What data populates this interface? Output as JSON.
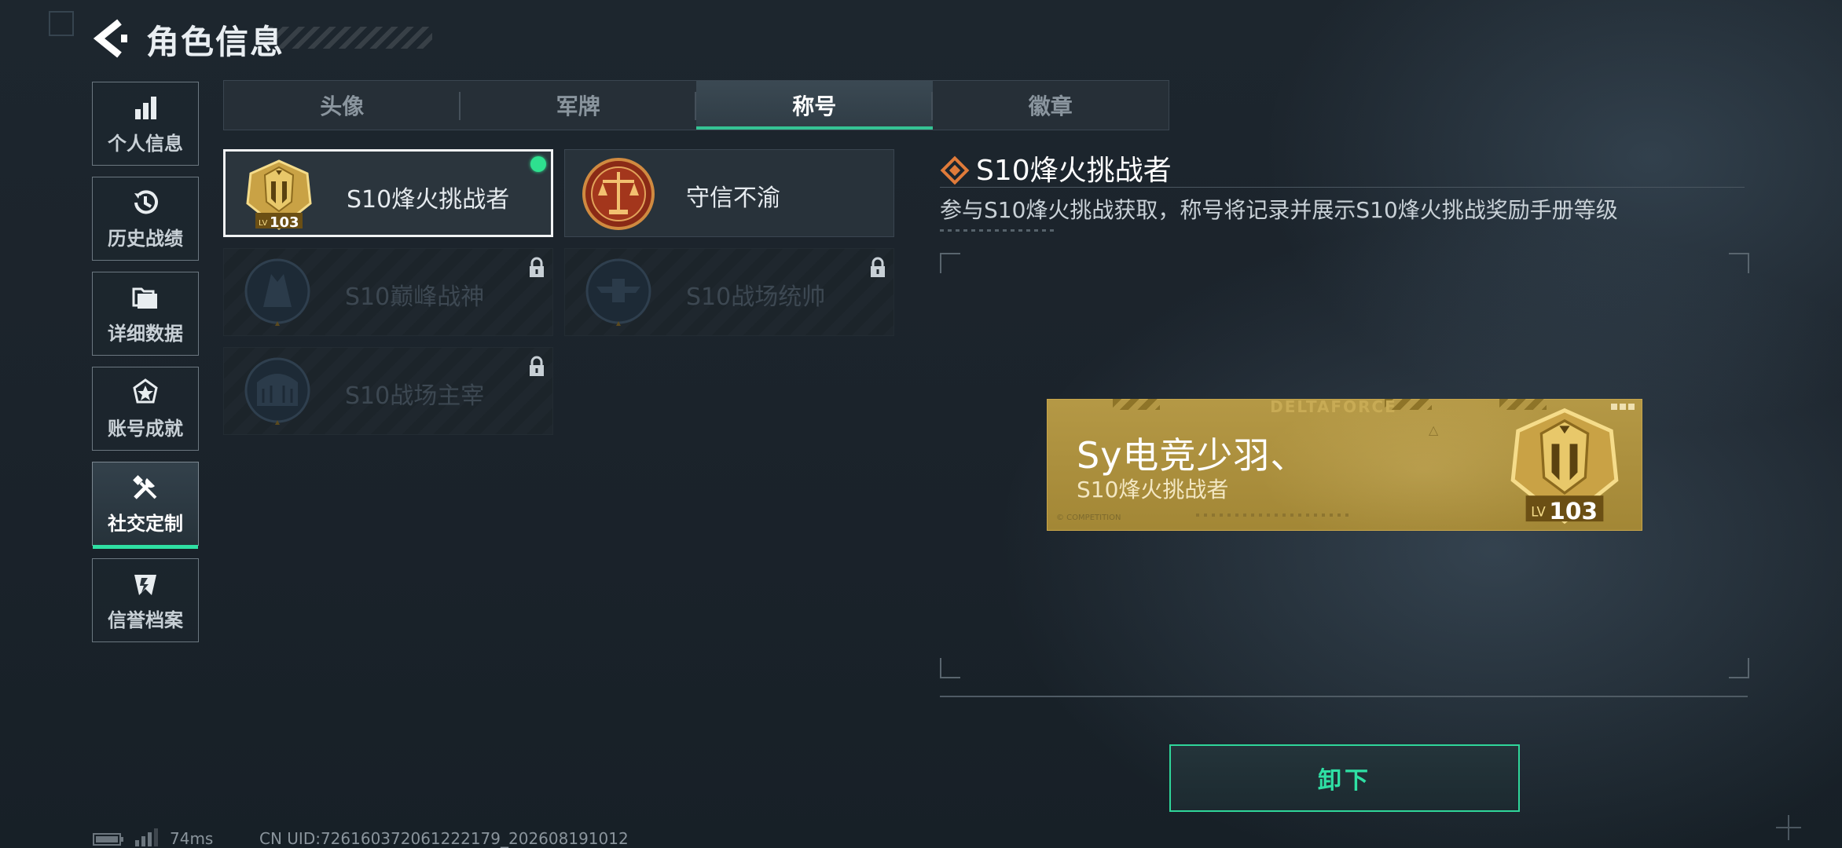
{
  "header": {
    "title": "角色信息"
  },
  "sidebar": {
    "items": [
      {
        "label": "个人信息",
        "icon": "bar-chart-icon"
      },
      {
        "label": "历史战绩",
        "icon": "history-icon"
      },
      {
        "label": "详细数据",
        "icon": "folder-icon"
      },
      {
        "label": "账号成就",
        "icon": "achievement-icon"
      },
      {
        "label": "社交定制",
        "icon": "tools-icon",
        "active": true
      },
      {
        "label": "信誉档案",
        "icon": "credit-shield-icon"
      }
    ]
  },
  "tabs": [
    {
      "label": "头像"
    },
    {
      "label": "军牌"
    },
    {
      "label": "称号",
      "active": true
    },
    {
      "label": "徽章"
    }
  ],
  "titles": [
    {
      "label": "S10烽火挑战者",
      "state": "equipped",
      "emblem_level": "103"
    },
    {
      "label": "守信不渝",
      "state": "owned"
    },
    {
      "label": "S10巅峰战神",
      "state": "locked"
    },
    {
      "label": "S10战场统帅",
      "state": "locked"
    },
    {
      "label": "S10战场主宰",
      "state": "locked"
    }
  ],
  "emblem": {
    "lv_prefix": "LV",
    "level": "103"
  },
  "detail": {
    "title": "S10烽火挑战者",
    "description": "参与S10烽火挑战获取，称号将记录并展示S10烽火挑战奖励手册等级"
  },
  "nameplate": {
    "brand": "DELTAFORCE",
    "player_name": "Sy电竞少羽、",
    "title": "S10烽火挑战者",
    "small_text": "© COMPETITION",
    "level": "103"
  },
  "actions": {
    "unequip_label": "卸下"
  },
  "status": {
    "ping": "74ms",
    "uid": "CN UID:726160372061222179_202608191012"
  },
  "colors": {
    "accent_green": "#2fe0a4",
    "plate_gold": "#b0923a",
    "background": "#1d262e"
  }
}
